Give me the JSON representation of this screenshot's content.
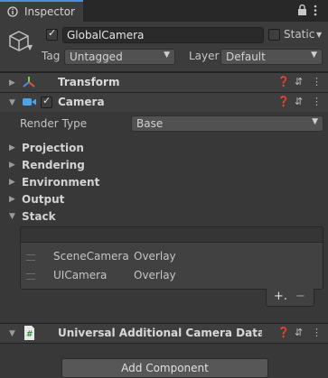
{
  "tab": {
    "label": "Inspector",
    "icon": "info-icon"
  },
  "top_icons": [
    "lock-icon",
    "kebab-menu-icon"
  ],
  "object": {
    "icon": "cube-icon",
    "active": true,
    "name": "GlobalCamera",
    "static_label": "Static",
    "tag_label": "Tag",
    "tag_value": "Untagged",
    "layer_label": "Layer",
    "layer_value": "Default"
  },
  "components": {
    "transform": {
      "title": "Transform",
      "icon": "transform-axes-icon"
    },
    "camera": {
      "title": "Camera",
      "icon": "camera-icon",
      "enabled": true,
      "render_type_label": "Render Type",
      "render_type_value": "Base",
      "sections": [
        "Projection",
        "Rendering",
        "Environment",
        "Output",
        "Stack"
      ],
      "stack": [
        {
          "name": "SceneCamera",
          "type": "Overlay"
        },
        {
          "name": "UICamera",
          "type": "Overlay"
        }
      ],
      "add_symbol": "+.",
      "remove_symbol": "−"
    },
    "additional": {
      "title": "Universal Additional Camera Data (Scrip",
      "icon": "csharp-script-icon"
    }
  },
  "add_component_label": "Add Component",
  "colors": {
    "accent": "#4a90e2",
    "background": "#383838",
    "header": "#3e3e3e"
  }
}
